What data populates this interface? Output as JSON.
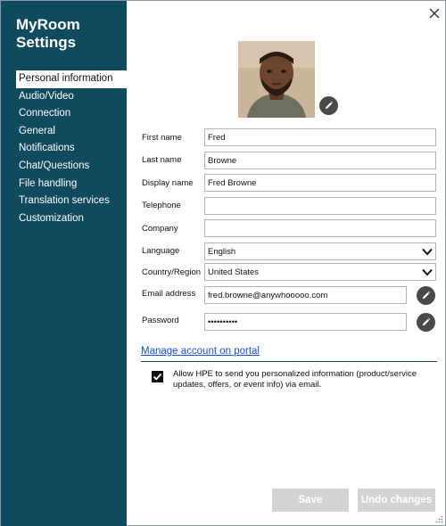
{
  "sidebar": {
    "title": "MyRoom\nSettings",
    "title_line1": "MyRoom",
    "title_line2": "Settings",
    "items": [
      {
        "label": "Personal information",
        "active": true
      },
      {
        "label": "Audio/Video"
      },
      {
        "label": "Connection"
      },
      {
        "label": "General"
      },
      {
        "label": "Notifications"
      },
      {
        "label": "Chat/Questions"
      },
      {
        "label": "File handling"
      },
      {
        "label": "Translation services"
      },
      {
        "label": "Customization"
      }
    ]
  },
  "form": {
    "first_name_label": "First name",
    "first_name_value": "Fred",
    "last_name_label": "Last name",
    "last_name_value": "Browne",
    "display_name_label": "Display name",
    "display_name_value": "Fred Browne",
    "telephone_label": "Telephone",
    "telephone_value": "",
    "company_label": "Company",
    "company_value": "",
    "language_label": "Language",
    "language_value": "English",
    "country_label": "Country/Region",
    "country_value": "United States",
    "email_label": "Email address",
    "email_value": "fred.browne@anywhooooo.com",
    "password_label": "Password",
    "password_value": "••••••••••"
  },
  "portal_link": "Manage account on portal",
  "consent": {
    "checked": true,
    "text": "Allow HPE to send you personalized information (product/service updates, offers, or event info) via email."
  },
  "footer": {
    "save_label": "Save",
    "undo_label": "Undo changes"
  },
  "icons": {
    "close": "close-icon",
    "edit": "pencil-icon",
    "chevron": "chevron-down-icon",
    "check": "check-icon",
    "grip": "resize-grip-icon"
  },
  "colors": {
    "sidebar_bg": "#0f4a5e",
    "link": "#1a4fd0",
    "disabled_button": "#d4d4d4"
  }
}
